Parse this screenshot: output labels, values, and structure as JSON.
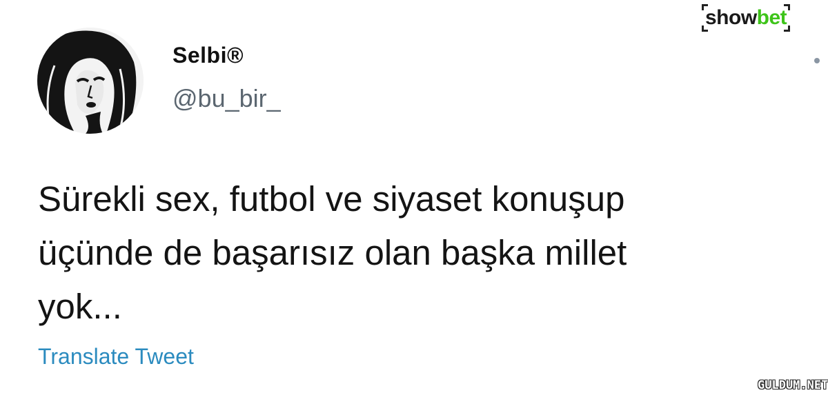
{
  "tweet": {
    "display_name": "Selbi®",
    "handle": "@bu_bir_",
    "text_lines": [
      "Sürekli sex, futbol ve siyaset konuşup",
      "üçünde de başarısız olan başka millet",
      "yok..."
    ],
    "translate_label": "Translate Tweet"
  },
  "branding": {
    "logo_part1": "show",
    "logo_part2": "bet",
    "watermark": "GULDUM.NET"
  },
  "icons": {
    "avatar": "avatar-portrait",
    "more": "more-options-icon"
  },
  "colors": {
    "text": "#141414",
    "handle": "#5b6670",
    "link": "#2b8bbf",
    "brand_green": "#3ec41a"
  }
}
